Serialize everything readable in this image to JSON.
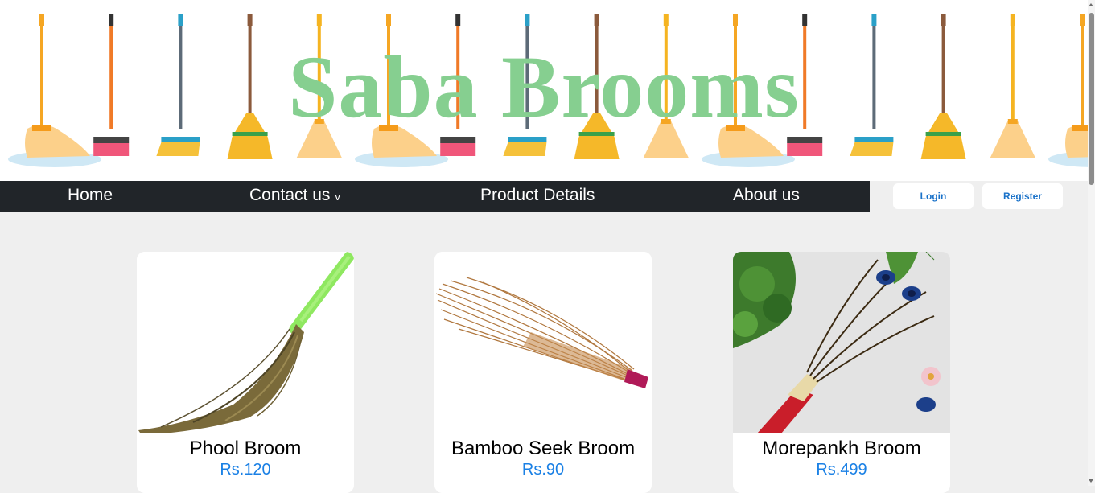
{
  "site": {
    "title": "Saba Brooms"
  },
  "nav": {
    "items": [
      {
        "label": "Home"
      },
      {
        "label": "Contact us",
        "caret": "v"
      },
      {
        "label": "Product Details"
      },
      {
        "label": "About us"
      }
    ]
  },
  "auth": {
    "login_label": "Login",
    "register_label": "Register"
  },
  "products": [
    {
      "name": "Phool Broom",
      "price": "Rs.120"
    },
    {
      "name": "Bamboo Seek Broom",
      "price": "Rs.90"
    },
    {
      "name": "Morepankh Broom",
      "price": "Rs.499"
    }
  ],
  "colors": {
    "title": "#86cf90",
    "navbar": "#212529",
    "price": "#1a80e5",
    "button_text": "#1a72c9",
    "page_bg": "#efefef"
  },
  "icons": {
    "nav_caret": "chevron-down-icon"
  }
}
